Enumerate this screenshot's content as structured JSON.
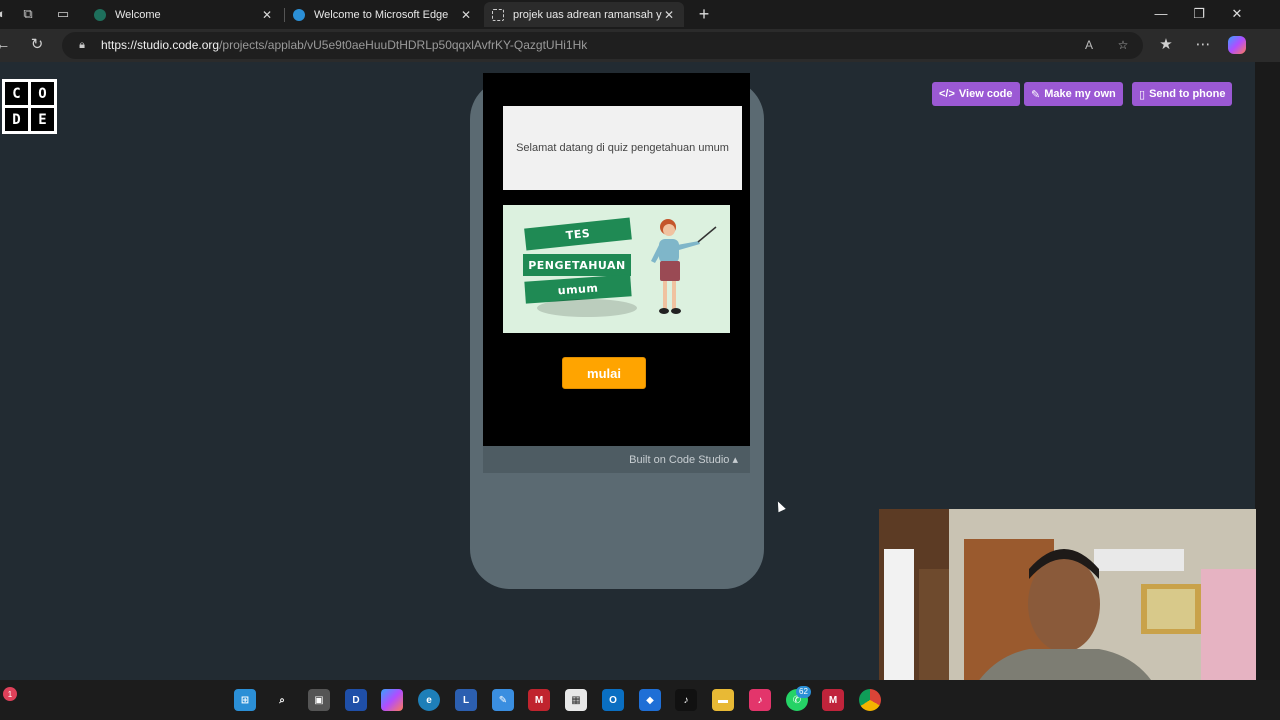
{
  "browser": {
    "tabs": [
      {
        "title": "Welcome",
        "active": false
      },
      {
        "title": "Welcome to Microsoft Edge",
        "active": false
      },
      {
        "title": "projek uas adrean ramansah yang",
        "active": true
      }
    ],
    "url_host": "https://studio.code.org",
    "url_path": "/projects/applab/vU5e9t0aeHuuDtHDRLp50qqxlAvfrKY-QazgtUHi1Hk",
    "window_controls": {
      "minimize": "—",
      "maximize": "❐",
      "close": "✕"
    }
  },
  "logo": {
    "letters": [
      "C",
      "O",
      "D",
      "E"
    ]
  },
  "header_buttons": {
    "view_code": "View code",
    "make_my_own": "Make my own",
    "send_to_phone": "Send to phone"
  },
  "app": {
    "welcome_text": "Selamat datang di quiz pengetahuan umum",
    "image_banners": [
      "TES",
      "PENGETAHUAN",
      "umum"
    ],
    "start_button": "mulai"
  },
  "footer": {
    "built_on": "Built on Code Studio ▴"
  },
  "taskbar": {
    "notification_count": "1",
    "whatsapp_badge": "62",
    "apps": [
      "start-icon",
      "search-icon",
      "task-view-icon",
      "devhome-icon",
      "copilot-icon",
      "edge-icon",
      "l-app-icon",
      "pen-app-icon",
      "mcafee-icon",
      "store-icon",
      "outlook-icon",
      "defender-icon",
      "tiktok-icon",
      "file-explorer-icon",
      "tiktok-alt-icon",
      "whatsapp-icon",
      "mendeley-icon",
      "chrome-icon"
    ]
  },
  "colors": {
    "page_bg": "#222b32",
    "phone_frame": "#5b6a72",
    "accent_purple": "#9b59d4",
    "start_orange": "#ffa400",
    "banner_green": "#1f8a54"
  }
}
